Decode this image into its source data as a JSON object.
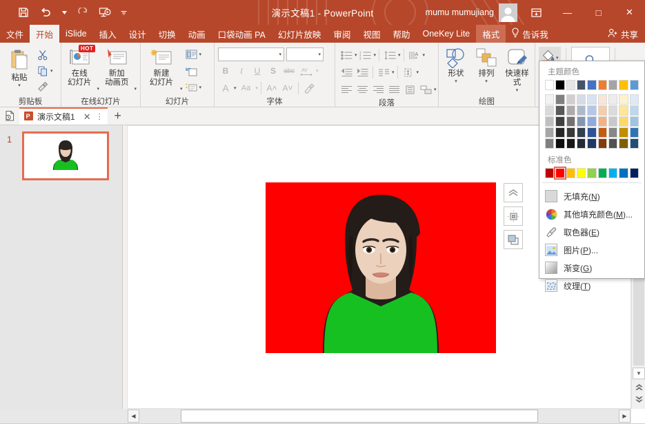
{
  "titlebar": {
    "doc_title": "演示文稿1  -  PowerPoint",
    "user_name": "mumu mumujiang",
    "qat": [
      {
        "name": "save-icon",
        "label": "保存"
      },
      {
        "name": "undo-icon",
        "label": "撤消"
      },
      {
        "name": "redo-icon",
        "label": "恢复"
      },
      {
        "name": "start-slideshow-icon",
        "label": "从头开始"
      },
      {
        "name": "qat-more-icon",
        "label": "自定义快速访问工具栏"
      }
    ],
    "window_buttons": {
      "ribbon_display": "⊡",
      "minimize": "—",
      "maximize": "□",
      "close": "✕"
    },
    "accent": "#b7472a"
  },
  "menubar": {
    "tabs": [
      {
        "label": "文件",
        "state": "normal"
      },
      {
        "label": "开始",
        "state": "active"
      },
      {
        "label": "iSlide",
        "state": "normal"
      },
      {
        "label": "插入",
        "state": "normal"
      },
      {
        "label": "设计",
        "state": "normal"
      },
      {
        "label": "切换",
        "state": "normal"
      },
      {
        "label": "动画",
        "state": "normal"
      },
      {
        "label": "口袋动画 PA",
        "state": "normal"
      },
      {
        "label": "幻灯片放映",
        "state": "normal"
      },
      {
        "label": "审阅",
        "state": "normal"
      },
      {
        "label": "视图",
        "state": "normal"
      },
      {
        "label": "帮助",
        "state": "normal"
      },
      {
        "label": "OneKey Lite",
        "state": "normal"
      },
      {
        "label": "格式",
        "state": "ctx-active"
      }
    ],
    "tell_me": "告诉我",
    "share": "共享"
  },
  "ribbon": {
    "groups": [
      {
        "name": "clipboard",
        "label": "剪贴板",
        "paste_label": "粘贴",
        "buttons": [
          "剪切",
          "复制",
          "格式刷"
        ],
        "has_launcher": true
      },
      {
        "name": "online-slides",
        "label": "在线幻灯片",
        "buttons": [
          {
            "label": "在线\n幻灯片",
            "badge": "HOT"
          },
          {
            "label": "新加\n动画页",
            "badge": ""
          }
        ],
        "has_launcher": false
      },
      {
        "name": "slides",
        "label": "幻灯片",
        "buttons": [
          {
            "label": "新建\n幻灯片",
            "badge": ""
          }
        ],
        "small_buttons": [
          "版式",
          "重置",
          "节"
        ],
        "has_launcher": false
      },
      {
        "name": "font",
        "label": "字体",
        "font_name": "",
        "font_size": "",
        "row1": [
          "B",
          "I",
          "U",
          "S",
          "abc",
          "AV"
        ],
        "row2": [
          "A",
          "Aa",
          "A↑",
          "A↓",
          "清除格式"
        ],
        "has_launcher": true
      },
      {
        "name": "paragraph",
        "label": "段落",
        "has_launcher": true
      },
      {
        "name": "drawing",
        "label": "绘图",
        "buttons": [
          "形状",
          "排列",
          "快速样式"
        ],
        "has_launcher": false
      },
      {
        "name": "editing",
        "label": "",
        "buttons": [
          "形状填充",
          "查找"
        ],
        "has_launcher": false
      }
    ]
  },
  "doctabs": {
    "tabs": [
      {
        "label": "演示文稿1",
        "close": "✕",
        "menu": "⋮"
      }
    ],
    "new_tab": "+"
  },
  "thumbnail_pane": {
    "slides": [
      {
        "number": "1",
        "selected": true
      }
    ]
  },
  "slide": {
    "photo": {
      "background_color": "#ff0000",
      "shirt_color": "#16c021",
      "description": "ID photo of a person on red background"
    },
    "float_tools": [
      {
        "name": "layout-options-icon",
        "label": "布局选项"
      },
      {
        "name": "position-icon",
        "label": "位置"
      },
      {
        "name": "bring-forward-icon",
        "label": "置于顶层"
      }
    ]
  },
  "scrollbars": {
    "vertical_up": "▲",
    "vertical_down": "▼",
    "prev_slide": "▲",
    "next_slide": "▼",
    "horizontal_left": "◀",
    "horizontal_right": "▶"
  },
  "color_panel": {
    "theme_title": "主题颜色",
    "standard_title": "标准色",
    "theme_row1": [
      "#ffffff",
      "#000000",
      "#e7e6e6",
      "#44546a",
      "#4472c4",
      "#ed7d31",
      "#a5a5a5",
      "#ffc000",
      "#5b9bd5"
    ],
    "theme_variants": [
      [
        "#f2f2f2",
        "#808080",
        "#d0cece",
        "#d6dce5",
        "#d9e2f3",
        "#fbe5d6",
        "#ededed",
        "#fff2cc",
        "#deebf7"
      ],
      [
        "#d9d9d9",
        "#595959",
        "#aeaaaa",
        "#adb9ca",
        "#b4c7e7",
        "#f8cbad",
        "#dbdbdb",
        "#ffe699",
        "#bdd7ee"
      ],
      [
        "#bfbfbf",
        "#404040",
        "#757171",
        "#8496b0",
        "#8faadc",
        "#f4b183",
        "#c9c9c9",
        "#ffd966",
        "#9dc3e6"
      ],
      [
        "#a6a6a6",
        "#262626",
        "#3b3838",
        "#323f4f",
        "#2f5496",
        "#c55a11",
        "#878787",
        "#bf8f00",
        "#2e75b6"
      ],
      [
        "#7f7f7f",
        "#0d0d0d",
        "#171616",
        "#222a35",
        "#1f3864",
        "#833c09",
        "#525252",
        "#7f6000",
        "#1f4e79"
      ]
    ],
    "standard_colors": [
      "#c00000",
      "#ff0000",
      "#ffc000",
      "#ffff00",
      "#92d050",
      "#00b050",
      "#00b0f0",
      "#0070c0",
      "#002060"
    ],
    "selected_standard_index": 1,
    "menu_items": [
      {
        "name": "no-fill",
        "label": "无填充",
        "accel": "N",
        "suffix": "",
        "icon": "swatch"
      },
      {
        "name": "more-fill-colors",
        "label": "其他填充颜色",
        "accel": "M",
        "suffix": "...",
        "icon": "palette"
      },
      {
        "name": "eyedropper",
        "label": "取色器",
        "accel": "E",
        "suffix": "",
        "icon": "dropper"
      },
      {
        "name": "picture-fill",
        "label": "图片",
        "accel": "P",
        "suffix": "...",
        "icon": "picture"
      },
      {
        "name": "gradient-fill",
        "label": "渐变",
        "accel": "G",
        "suffix": "",
        "icon": "gradient"
      },
      {
        "name": "texture-fill",
        "label": "纹理",
        "accel": "T",
        "suffix": "",
        "icon": "texture"
      }
    ]
  }
}
